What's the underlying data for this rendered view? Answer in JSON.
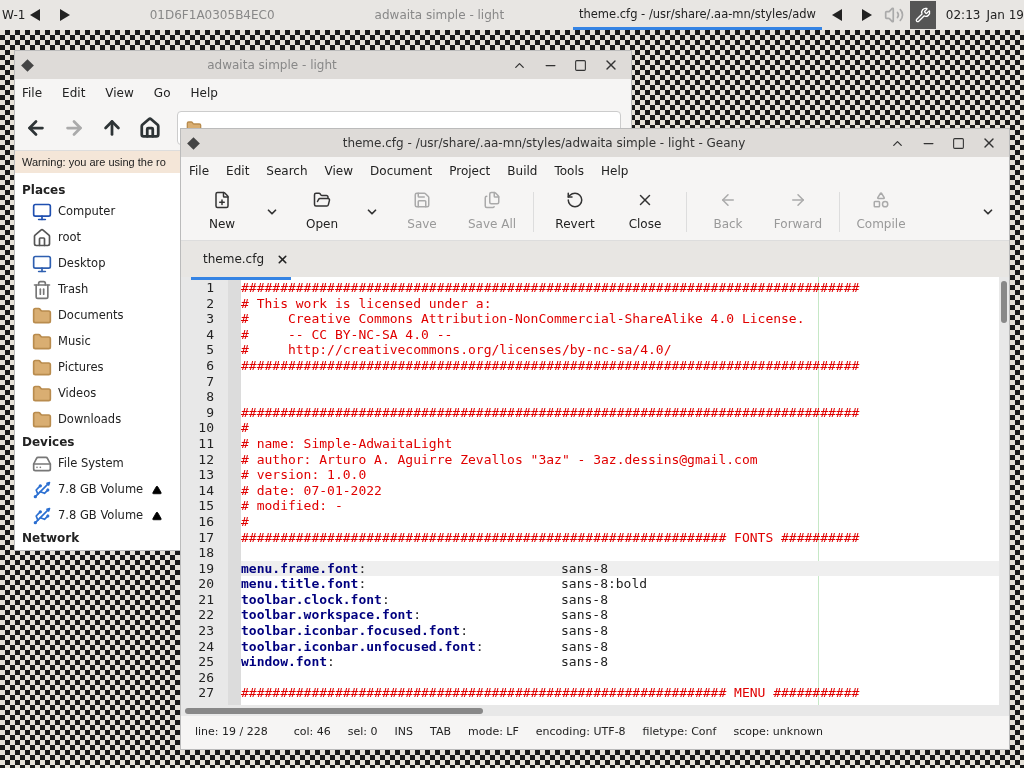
{
  "panel": {
    "workspace": "W-1",
    "window_id": "01D6F1A0305B4EC0",
    "tasks": [
      {
        "label": "adwaita simple - light",
        "selected": false
      },
      {
        "label": "theme.cfg - /usr/share/.aa-mn/styles/adw",
        "selected": true
      }
    ],
    "time": "02:13",
    "date": "Jan 19"
  },
  "file_manager": {
    "title": "adwaita simple - light",
    "menu": [
      "File",
      "Edit",
      "View",
      "Go",
      "Help"
    ],
    "toolbar": [
      {
        "kind": "back",
        "disabled": false
      },
      {
        "kind": "forward",
        "disabled": true
      },
      {
        "kind": "up",
        "disabled": false
      },
      {
        "kind": "home",
        "disabled": false
      }
    ],
    "warning": "Warning: you are using the ro",
    "sidebar": [
      {
        "heading": "Places",
        "items": [
          {
            "label": "Computer",
            "kind": "computer",
            "ejectable": false
          },
          {
            "label": "root",
            "kind": "home",
            "ejectable": false
          },
          {
            "label": "Desktop",
            "kind": "desktop",
            "ejectable": false
          },
          {
            "label": "Trash",
            "kind": "trash",
            "ejectable": false
          },
          {
            "label": "Documents",
            "kind": "folder",
            "ejectable": false
          },
          {
            "label": "Music",
            "kind": "folder",
            "ejectable": false
          },
          {
            "label": "Pictures",
            "kind": "folder",
            "ejectable": false
          },
          {
            "label": "Videos",
            "kind": "folder",
            "ejectable": false
          },
          {
            "label": "Downloads",
            "kind": "folder",
            "ejectable": false
          }
        ]
      },
      {
        "heading": "Devices",
        "items": [
          {
            "label": "File System",
            "kind": "drive",
            "ejectable": false
          },
          {
            "label": "7.8 GB Volume",
            "kind": "usb",
            "ejectable": true
          },
          {
            "label": "7.8 GB Volume",
            "kind": "usb",
            "ejectable": true
          }
        ]
      },
      {
        "heading": "Network"
      }
    ]
  },
  "geany": {
    "title": "theme.cfg - /usr/share/.aa-mn/styles/adwaita simple - light - Geany",
    "menu": [
      "File",
      "Edit",
      "Search",
      "View",
      "Document",
      "Project",
      "Build",
      "Tools",
      "Help"
    ],
    "toolbar": [
      {
        "kind": "new",
        "label": "New",
        "disabled": false,
        "dropdown": true
      },
      {
        "kind": "open",
        "label": "Open",
        "disabled": false,
        "dropdown": true
      },
      {
        "kind": "save",
        "label": "Save",
        "disabled": true,
        "dropdown": false
      },
      {
        "kind": "save_all",
        "label": "Save All",
        "disabled": true,
        "dropdown": false
      },
      {
        "kind": "separator"
      },
      {
        "kind": "revert",
        "label": "Revert",
        "disabled": false,
        "dropdown": false
      },
      {
        "kind": "close",
        "label": "Close",
        "disabled": false,
        "dropdown": false
      },
      {
        "kind": "separator"
      },
      {
        "kind": "back",
        "label": "Back",
        "disabled": true,
        "dropdown": false
      },
      {
        "kind": "forward",
        "label": "Forward",
        "disabled": true,
        "dropdown": false
      },
      {
        "kind": "separator"
      },
      {
        "kind": "compile",
        "label": "Compile",
        "disabled": true,
        "dropdown": false
      }
    ],
    "tabs": [
      {
        "label": "theme.cfg",
        "selected": true
      }
    ],
    "lines": [
      {
        "number": "1",
        "kind": "comment",
        "text": "###############################################################################",
        "current": false
      },
      {
        "number": "2",
        "kind": "comment",
        "text": "# This work is licensed under a:",
        "current": false
      },
      {
        "number": "3",
        "kind": "comment",
        "text": "#     Creative Commons Attribution-NonCommercial-ShareAlike 4.0 License.",
        "current": false
      },
      {
        "number": "4",
        "kind": "comment",
        "text": "#     -- CC BY-NC-SA 4.0 --",
        "current": false
      },
      {
        "number": "5",
        "kind": "comment",
        "text": "#     http://creativecommons.org/licenses/by-nc-sa/4.0/",
        "current": false
      },
      {
        "number": "6",
        "kind": "comment",
        "text": "###############################################################################",
        "current": false
      },
      {
        "number": "7",
        "kind": "blank",
        "current": false
      },
      {
        "number": "8",
        "kind": "blank",
        "current": false
      },
      {
        "number": "9",
        "kind": "comment",
        "text": "###############################################################################",
        "current": false
      },
      {
        "number": "10",
        "kind": "comment",
        "text": "#",
        "current": false
      },
      {
        "number": "11",
        "kind": "comment",
        "text": "# name: Simple-AdwaitaLight",
        "current": false
      },
      {
        "number": "12",
        "kind": "comment",
        "text": "# author: Arturo A. Aguirre Zevallos \"3az\" - 3az.dessins@gmail.com",
        "current": false
      },
      {
        "number": "13",
        "kind": "comment",
        "text": "# version: 1.0.0",
        "current": false
      },
      {
        "number": "14",
        "kind": "comment",
        "text": "# date: 07-01-2022",
        "current": false
      },
      {
        "number": "15",
        "kind": "comment",
        "text": "# modified: -",
        "current": false
      },
      {
        "number": "16",
        "kind": "comment",
        "text": "#",
        "current": false
      },
      {
        "number": "17",
        "kind": "comment",
        "text": "############################################################## FONTS ##########",
        "current": false
      },
      {
        "number": "18",
        "kind": "blank",
        "current": false
      },
      {
        "number": "19",
        "kind": "setting",
        "key": "menu.frame.font",
        "separator": ":",
        "value": "sans-8",
        "current": true
      },
      {
        "number": "20",
        "kind": "setting",
        "key": "menu.title.font",
        "separator": ":",
        "value": "sans-8:bold",
        "current": false
      },
      {
        "number": "21",
        "kind": "setting",
        "key": "toolbar.clock.font",
        "separator": ":",
        "value": "sans-8",
        "current": false
      },
      {
        "number": "22",
        "kind": "setting",
        "key": "toolbar.workspace.font",
        "separator": ":",
        "value": "sans-8",
        "current": false
      },
      {
        "number": "23",
        "kind": "setting",
        "key": "toolbar.iconbar.focused.font",
        "separator": ":",
        "value": "sans-8",
        "current": false
      },
      {
        "number": "24",
        "kind": "setting",
        "key": "toolbar.iconbar.unfocused.font",
        "separator": ":",
        "value": "sans-8",
        "current": false
      },
      {
        "number": "25",
        "kind": "setting",
        "key": "window.font",
        "separator": ":",
        "value": "sans-8",
        "current": false
      },
      {
        "number": "26",
        "kind": "blank",
        "current": false
      },
      {
        "number": "27",
        "kind": "comment",
        "text": "############################################################## MENU ###########",
        "current": false
      }
    ],
    "status": [
      "line: 19 / 228",
      "col: 46",
      "sel: 0",
      "INS",
      "TAB",
      "mode: LF",
      "encoding: UTF-8",
      "filetype: Conf",
      "scope: unknown"
    ]
  }
}
